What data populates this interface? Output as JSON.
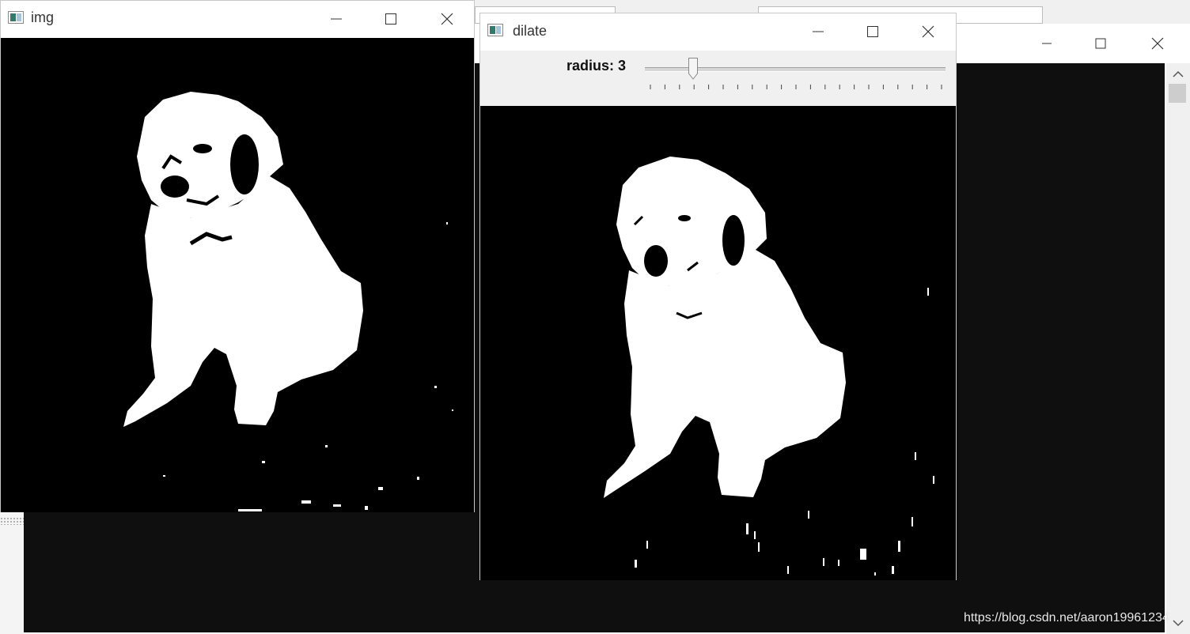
{
  "windows": {
    "img": {
      "title": "img"
    },
    "dilate": {
      "title": "dilate",
      "trackbar": {
        "label": "radius: 3",
        "value": 3,
        "max": 20
      }
    }
  },
  "watermark": "https://blog.csdn.net/aaron19961234",
  "colors": {
    "image_bg": "#000000",
    "foreground": "#ffffff",
    "titlebar": "#ffffff",
    "panel": "#f0f0f0"
  },
  "icons": {
    "minimize": "minimize-icon",
    "maximize": "maximize-icon",
    "close": "close-icon",
    "app": "app-window-icon"
  }
}
